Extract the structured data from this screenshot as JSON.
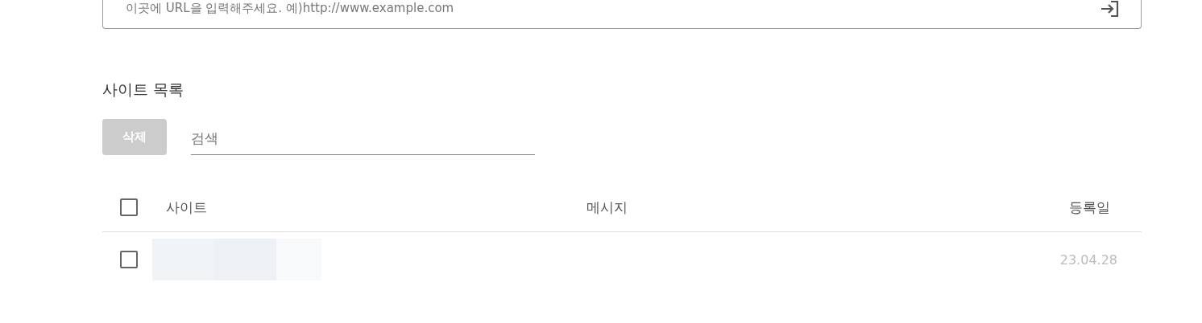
{
  "url_field": {
    "placeholder": "이곳에 URL을 입력해주세요. 예)http://www.example.com"
  },
  "section_title": "사이트 목록",
  "toolbar": {
    "delete_button": {
      "label": "삭제",
      "disabled": true
    },
    "search": {
      "placeholder": "검색"
    }
  },
  "table": {
    "select_all": {
      "checked": false
    },
    "columns": [
      "사이트",
      "메시지",
      "등록일"
    ],
    "rows": [
      {
        "checked": false,
        "site": {
          "kind": "redacted"
        },
        "date": "23.04.28"
      }
    ]
  }
}
